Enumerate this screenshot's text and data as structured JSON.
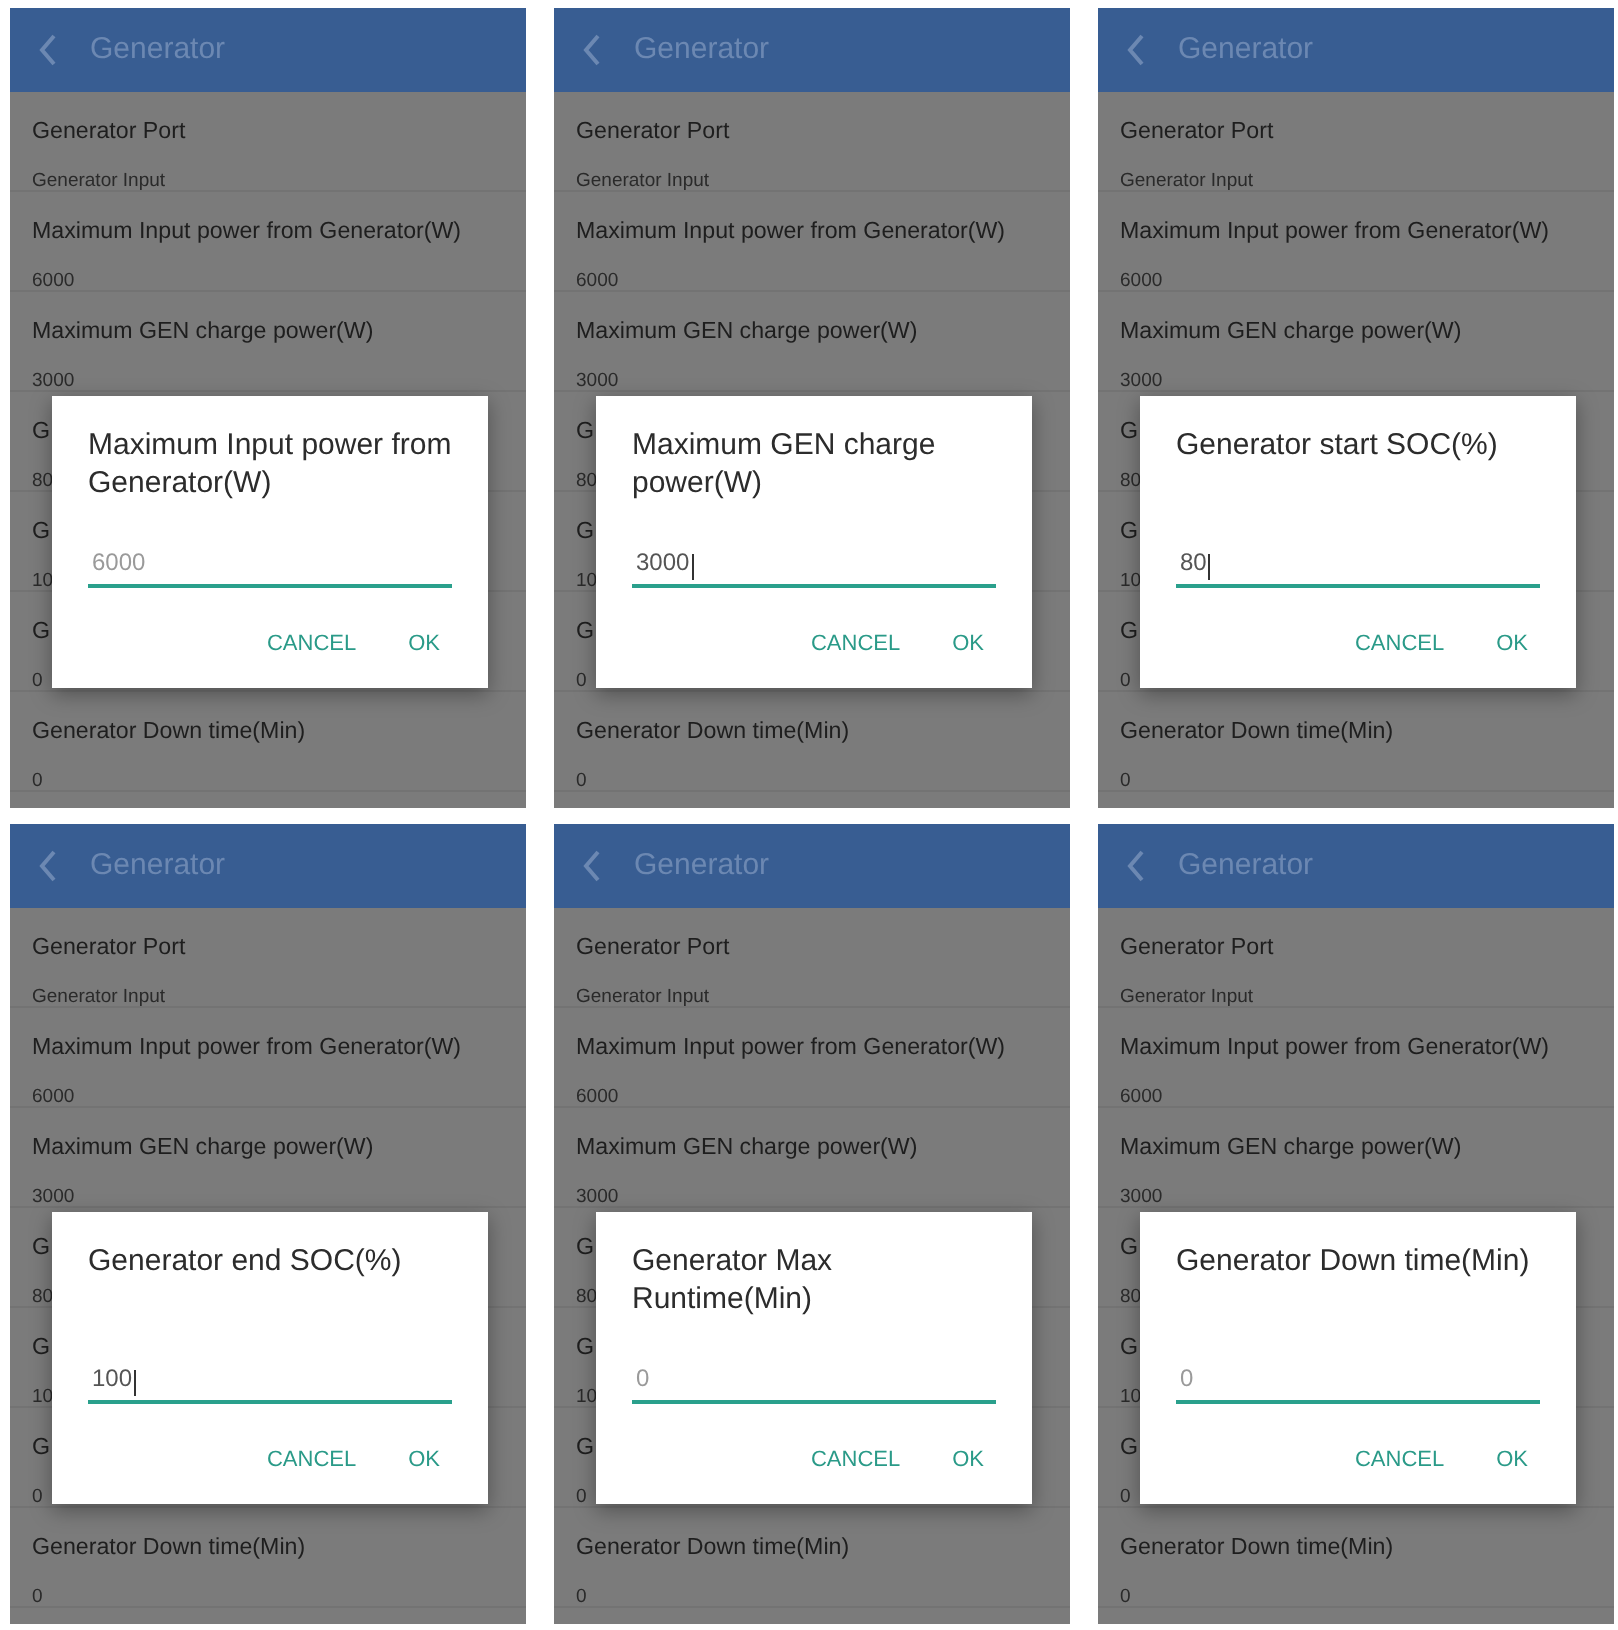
{
  "screens": [
    {
      "title": "Generator",
      "settings": [
        {
          "label": "Generator Port",
          "value": "Generator Input"
        },
        {
          "label": "Maximum Input power from Generator(W)",
          "value": "6000"
        },
        {
          "label": "Maximum GEN charge power(W)",
          "value": "3000"
        },
        {
          "label": "G",
          "value": "80"
        },
        {
          "label": "G",
          "value": "10"
        },
        {
          "label": "G",
          "value": "0"
        },
        {
          "label": "Generator Down time(Min)",
          "value": "0"
        }
      ],
      "dialog": {
        "title": "Maximum Input power from Generator(W)",
        "placeholder": "6000",
        "focused": false,
        "buttons": [
          "CANCEL",
          "OK"
        ]
      }
    },
    {
      "title": "Generator",
      "settings": [
        {
          "label": "Generator Port",
          "value": "Generator Input"
        },
        {
          "label": "Maximum Input power from Generator(W)",
          "value": "6000"
        },
        {
          "label": "Maximum GEN charge power(W)",
          "value": "3000"
        },
        {
          "label": "G",
          "value": "80"
        },
        {
          "label": "G",
          "value": "10"
        },
        {
          "label": "G",
          "value": "0"
        },
        {
          "label": "Generator Down time(Min)",
          "value": "0"
        }
      ],
      "dialog": {
        "title": "Maximum GEN charge power(W)",
        "value": "3000",
        "focused": true,
        "buttons": [
          "CANCEL",
          "OK"
        ]
      }
    },
    {
      "title": "Generator",
      "settings": [
        {
          "label": "Generator Port",
          "value": "Generator Input"
        },
        {
          "label": "Maximum Input power from Generator(W)",
          "value": "6000"
        },
        {
          "label": "Maximum GEN charge power(W)",
          "value": "3000"
        },
        {
          "label": "G",
          "value": "80"
        },
        {
          "label": "G",
          "value": "10"
        },
        {
          "label": "G",
          "value": "0"
        },
        {
          "label": "Generator Down time(Min)",
          "value": "0"
        }
      ],
      "dialog": {
        "title": "Generator start SOC(%)",
        "value": "80",
        "focused": true,
        "buttons": [
          "CANCEL",
          "OK"
        ]
      }
    },
    {
      "title": "Generator",
      "settings": [
        {
          "label": "Generator Port",
          "value": "Generator Input"
        },
        {
          "label": "Maximum Input power from Generator(W)",
          "value": "6000"
        },
        {
          "label": "Maximum GEN charge power(W)",
          "value": "3000"
        },
        {
          "label": "G",
          "value": "80"
        },
        {
          "label": "G",
          "value": "10"
        },
        {
          "label": "G",
          "value": "0"
        },
        {
          "label": "Generator Down time(Min)",
          "value": "0"
        }
      ],
      "dialog": {
        "title": "Generator end SOC(%)",
        "value": "100",
        "focused": true,
        "buttons": [
          "CANCEL",
          "OK"
        ]
      }
    },
    {
      "title": "Generator",
      "settings": [
        {
          "label": "Generator Port",
          "value": "Generator Input"
        },
        {
          "label": "Maximum Input power from Generator(W)",
          "value": "6000"
        },
        {
          "label": "Maximum GEN charge power(W)",
          "value": "3000"
        },
        {
          "label": "G",
          "value": "80"
        },
        {
          "label": "G",
          "value": "10"
        },
        {
          "label": "G",
          "value": "0"
        },
        {
          "label": "Generator Down time(Min)",
          "value": "0"
        }
      ],
      "dialog": {
        "title": "Generator Max Runtime(Min)",
        "placeholder": "0",
        "focused": false,
        "buttons": [
          "CANCEL",
          "OK"
        ]
      }
    },
    {
      "title": "Generator",
      "settings": [
        {
          "label": "Generator Port",
          "value": "Generator Input"
        },
        {
          "label": "Maximum Input power from Generator(W)",
          "value": "6000"
        },
        {
          "label": "Maximum GEN charge power(W)",
          "value": "3000"
        },
        {
          "label": "G",
          "value": "80"
        },
        {
          "label": "G",
          "value": "10"
        },
        {
          "label": "G",
          "value": "0"
        },
        {
          "label": "Generator Down time(Min)",
          "value": "0"
        }
      ],
      "dialog": {
        "title": "Generator Down time(Min)",
        "placeholder": "0",
        "focused": false,
        "buttons": [
          "CANCEL",
          "OK"
        ]
      }
    }
  ]
}
